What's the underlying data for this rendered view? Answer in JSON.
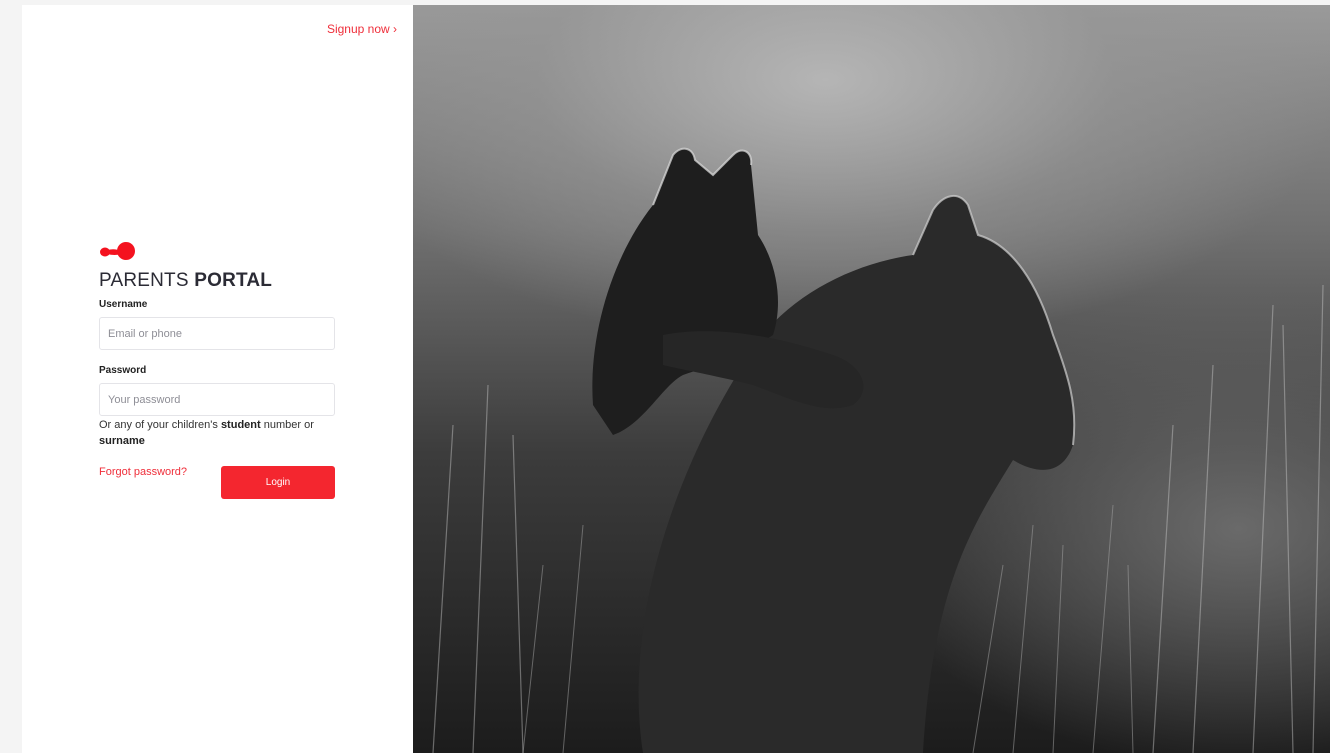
{
  "header": {
    "signup_label": "Signup now ›"
  },
  "brand": {
    "title_light": "PARENTS ",
    "title_bold": "PORTAL",
    "logo_icon": "red-blob-logo-icon",
    "accent_color": "#ef2e3a"
  },
  "form": {
    "username_label": "Username",
    "username_placeholder": "Email or phone",
    "username_value": "",
    "password_label": "Password",
    "password_placeholder": "Your password",
    "password_value": "",
    "hint_prefix": "Or any of your children's ",
    "hint_bold_1": "student",
    "hint_middle": " number or ",
    "hint_bold_2": "surname",
    "forgot_label": "Forgot password?",
    "login_label": "Login",
    "button_color": "#f4262f"
  },
  "background_image": {
    "alt": "lion-cub-with-lioness-photo"
  }
}
